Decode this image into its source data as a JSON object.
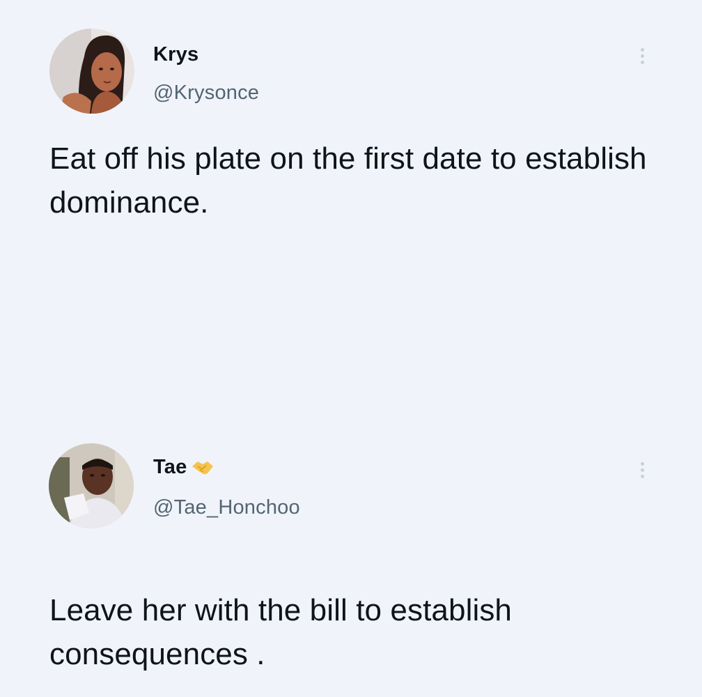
{
  "tweets": [
    {
      "display_name": "Krys",
      "handle": "@Krysonce",
      "text": "Eat off his plate on the first date to establish dominance.",
      "avatar_icon": "avatar-photo-woman",
      "more_icon": "vertical-ellipsis-icon"
    },
    {
      "display_name": "Tae",
      "name_emoji": "handshake-emoji",
      "handle": "@Tae_Honchoo",
      "text": "Leave her with the bill to establish consequences .",
      "avatar_icon": "avatar-photo-man",
      "more_icon": "vertical-ellipsis-icon"
    }
  ],
  "colors": {
    "background": "#f0f4fa",
    "text_primary": "#0f1419",
    "text_secondary": "#536471",
    "more_dots": "#c9d0d8",
    "emoji": "#f5c44e"
  }
}
